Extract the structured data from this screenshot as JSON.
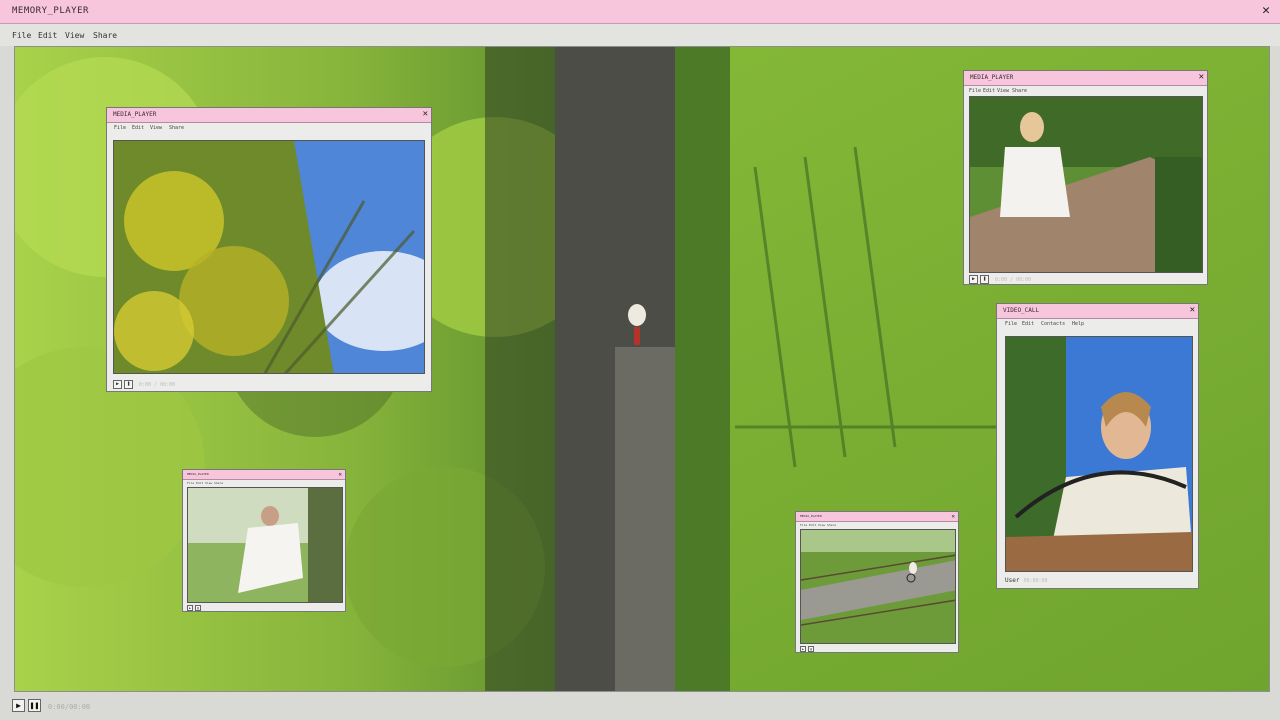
{
  "window": {
    "title": "MEMORY_PLAYER",
    "close_glyph": "✕",
    "menu": [
      "File",
      "Edit",
      "View",
      "Share"
    ]
  },
  "footer": {
    "play_glyph": "▶",
    "pause_glyph": "❚❚",
    "status": "0:00/00:00"
  },
  "windows": {
    "media1": {
      "title": "MEDIA_PLAYER",
      "menu": [
        "File",
        "Edit",
        "View",
        "Share"
      ],
      "status": "0:00 / 00:00"
    },
    "media2": {
      "title": "MEDIA_PLAYER",
      "menu": [
        "File",
        "Edit",
        "View",
        "Share"
      ],
      "status": "0:00 / 00:00"
    },
    "video_call": {
      "title": "VIDEO_CALL",
      "menu": [
        "File",
        "Edit",
        "Contacts",
        "Help"
      ],
      "user_label": "User",
      "status": "00:00:00"
    },
    "mini1": {
      "title": "MEDIA_PLAYER",
      "menu": [
        "File",
        "Edit",
        "View",
        "Share"
      ]
    },
    "mini2": {
      "title": "MEDIA_PLAYER",
      "menu": [
        "File",
        "Edit",
        "View",
        "Share"
      ]
    }
  },
  "icons": {
    "close": "close-icon",
    "play": "play-icon",
    "pause": "pause-icon"
  },
  "colors": {
    "titlebar": "#f7c6dc",
    "chrome": "#e3e3e0",
    "sky": "#4f86d8",
    "grass": "#7fb23a",
    "foliage": "#9ccc3c",
    "road": "#4d4d48"
  }
}
